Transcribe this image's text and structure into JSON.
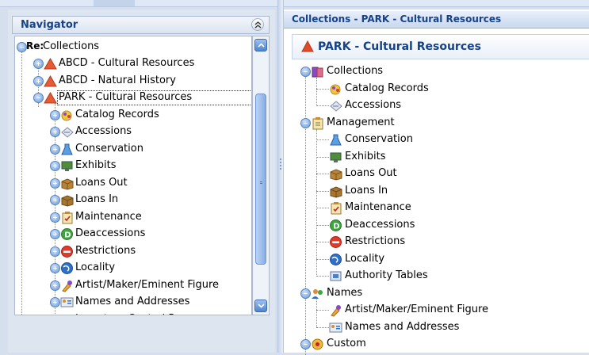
{
  "navigator": {
    "title": "Navigator",
    "root_prefix": "Re:",
    "root_label": "Collections",
    "items": [
      {
        "label": "ABCD - Cultural Resources",
        "icon": "red-triangle-icon"
      },
      {
        "label": "ABCD - Natural History",
        "icon": "red-triangle-icon"
      },
      {
        "label": "PARK  - Cultural Resources",
        "icon": "red-triangle-icon"
      }
    ],
    "park_children": [
      {
        "label": "Catalog Records",
        "icon": "catalog-records-icon"
      },
      {
        "label": "Accessions",
        "icon": "accessions-icon"
      },
      {
        "label": "Conservation",
        "icon": "conservation-flask-icon"
      },
      {
        "label": "Exhibits",
        "icon": "exhibits-monitor-icon"
      },
      {
        "label": "Loans Out",
        "icon": "loans-out-box-icon"
      },
      {
        "label": "Loans In",
        "icon": "loans-in-box-icon"
      },
      {
        "label": "Maintenance",
        "icon": "maintenance-clipboard-icon"
      },
      {
        "label": "Deaccessions",
        "icon": "deaccessions-green-d-icon"
      },
      {
        "label": "Restrictions",
        "icon": "restrictions-no-entry-icon"
      },
      {
        "label": "Locality",
        "icon": "locality-globe-icon"
      },
      {
        "label": "Artist/Maker/Eminent Figure",
        "icon": "artist-icon"
      },
      {
        "label": "Names and Addresses",
        "icon": "names-addresses-card-icon"
      },
      {
        "label": "Inventory Control R...",
        "icon": "inventory-icon"
      }
    ]
  },
  "right": {
    "header": "Collections - PARK  - Cultural Resources",
    "title": "PARK  - Cultural Resources",
    "groups": [
      {
        "label": "Collections",
        "icon": "collections-icon",
        "children": [
          {
            "label": "Catalog Records",
            "icon": "catalog-records-icon"
          },
          {
            "label": "Accessions",
            "icon": "accessions-icon"
          }
        ]
      },
      {
        "label": "Management",
        "icon": "management-clipboard-icon",
        "children": [
          {
            "label": "Conservation",
            "icon": "conservation-flask-icon"
          },
          {
            "label": "Exhibits",
            "icon": "exhibits-monitor-icon"
          },
          {
            "label": "Loans Out",
            "icon": "loans-out-box-icon"
          },
          {
            "label": "Loans In",
            "icon": "loans-in-box-icon"
          },
          {
            "label": "Maintenance",
            "icon": "maintenance-clipboard-icon"
          },
          {
            "label": "Deaccessions",
            "icon": "deaccessions-green-d-icon"
          },
          {
            "label": "Restrictions",
            "icon": "restrictions-no-entry-icon"
          },
          {
            "label": "Locality",
            "icon": "locality-globe-icon"
          },
          {
            "label": "Authority Tables",
            "icon": "authority-tables-icon"
          }
        ]
      },
      {
        "label": "Names",
        "icon": "names-people-icon",
        "children": [
          {
            "label": "Artist/Maker/Eminent Figure",
            "icon": "artist-icon"
          },
          {
            "label": "Names and Addresses",
            "icon": "names-addresses-card-icon"
          }
        ]
      },
      {
        "label": "Custom",
        "icon": "custom-icon",
        "children": []
      }
    ]
  },
  "colors": {
    "header_text": "#15428b",
    "accent_blue": "#6d9bd8",
    "warning_red": "#e04a2a"
  }
}
